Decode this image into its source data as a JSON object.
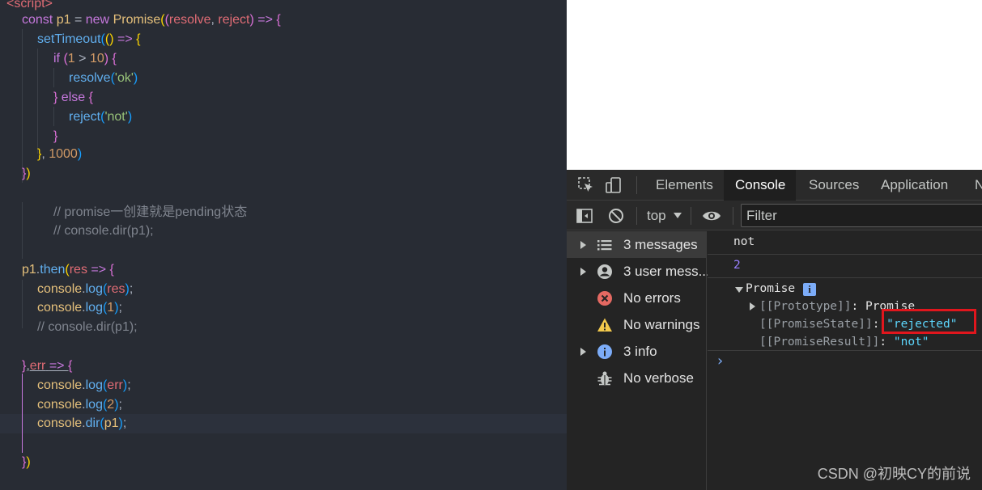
{
  "editor": {
    "top_tag": "<script>",
    "code": {
      "l1": [
        "const",
        "p1",
        "=",
        "new",
        "Promise",
        "resolve",
        "reject",
        "=>"
      ],
      "set_timeout": "setTimeout",
      "if_kw": "if",
      "num_1": "1",
      "num_10": "10",
      "resolve_fn": "resolve",
      "ok_str": "'ok'",
      "else_kw": "else",
      "reject_fn": "reject",
      "not_str": "'not'",
      "num_1000": "1000",
      "comment_1": "// promise一创建就是pending状态",
      "comment_2": "// console.dir(p1);",
      "then_obj": "p1",
      "then_fn": "then",
      "res_param": "res",
      "console": "console",
      "log": "log",
      "dir": "dir",
      "comment_3": "// console.dir(p1);",
      "err_param": "err",
      "num_2": "2"
    }
  },
  "devtools": {
    "tabs": [
      {
        "label": "Elements"
      },
      {
        "label": "Console"
      },
      {
        "label": "Sources"
      },
      {
        "label": "Application"
      },
      {
        "label": "N"
      }
    ],
    "selected_tab": "Console",
    "toolbar": {
      "context": "top",
      "filter_placeholder": "Filter"
    },
    "sidebar": [
      {
        "label": "3 messages",
        "icon": "list-icon",
        "expandable": true
      },
      {
        "label": "3 user mess...",
        "icon": "user-icon",
        "expandable": true
      },
      {
        "label": "No errors",
        "icon": "error-icon",
        "expandable": false
      },
      {
        "label": "No warnings",
        "icon": "warning-icon",
        "expandable": false
      },
      {
        "label": "3 info",
        "icon": "info-icon",
        "expandable": true
      },
      {
        "label": "No verbose",
        "icon": "bug-icon",
        "expandable": false
      }
    ],
    "console": {
      "log_1": "not",
      "log_2": "2",
      "promise_label": "Promise",
      "prototype_key": "[[Prototype]]",
      "prototype_val": "Promise",
      "state_key": "[[PromiseState]]",
      "state_val": "\"rejected\"",
      "result_key": "[[PromiseResult]]",
      "result_val": "\"not\"",
      "colon": ": ",
      "prompt": "›"
    }
  },
  "watermark": "CSDN @初映CY的前说",
  "colors": {
    "editor_bg": "#282c34",
    "devtools_bg": "#242424",
    "highlight_box": "#e0161d",
    "string_value": "#5cd5fb"
  }
}
